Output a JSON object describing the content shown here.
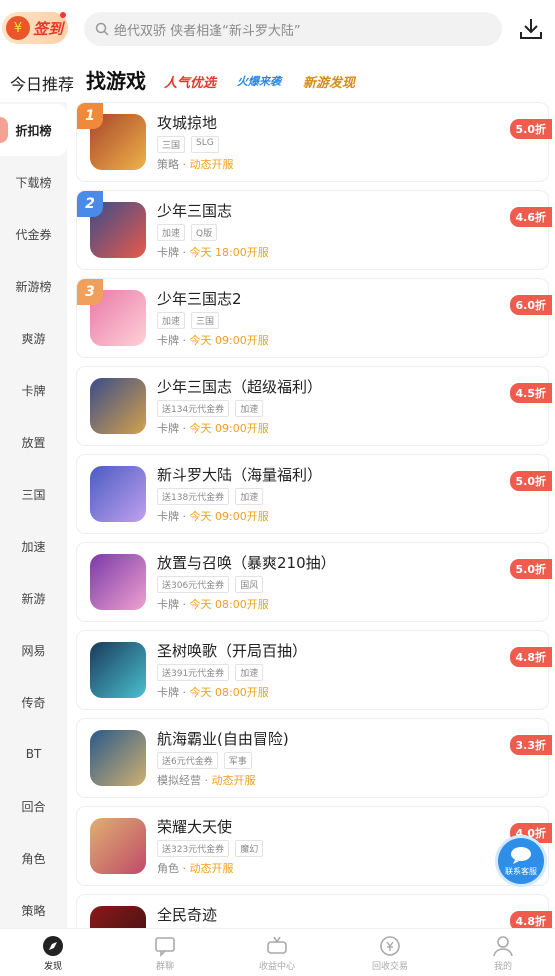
{
  "header": {
    "sign_label": "签到",
    "search_placeholder": "绝代双骄 侠者相逢“新斗罗大陆”",
    "download_icon": "download-icon"
  },
  "tabs": {
    "today": "今日推荐",
    "find": "找游戏",
    "hot": "人气优选",
    "boom": "火爆来袭",
    "new": "新游发现"
  },
  "sidebar": {
    "items": [
      "折扣榜",
      "下载榜",
      "代金券",
      "新游榜",
      "爽游",
      "卡牌",
      "放置",
      "三国",
      "加速",
      "新游",
      "网易",
      "传奇",
      "BT",
      "回合",
      "角色",
      "策略"
    ]
  },
  "games": [
    {
      "rank": "1",
      "name": "攻城掠地",
      "tags": [
        "三国",
        "SLG"
      ],
      "genre": "策略",
      "sep": " · ",
      "status": "动态开服",
      "discount": "5.0折"
    },
    {
      "rank": "2",
      "name": "少年三国志",
      "tags": [
        "加速",
        "Q版"
      ],
      "genre": "卡牌",
      "sep": " · ",
      "status": "今天 18:00开服",
      "discount": "4.6折"
    },
    {
      "rank": "3",
      "name": "少年三国志2",
      "tags": [
        "加速",
        "三国"
      ],
      "genre": "卡牌",
      "sep": " · ",
      "status": "今天 09:00开服",
      "discount": "6.0折"
    },
    {
      "rank": "",
      "name": "少年三国志（超级福利）",
      "tags": [
        "送134元代金券",
        "加速"
      ],
      "genre": "卡牌",
      "sep": " · ",
      "status": "今天 09:00开服",
      "discount": "4.5折"
    },
    {
      "rank": "",
      "name": "新斗罗大陆（海量福利）",
      "tags": [
        "送138元代金券",
        "加速"
      ],
      "genre": "卡牌",
      "sep": " · ",
      "status": "今天 09:00开服",
      "discount": "5.0折"
    },
    {
      "rank": "",
      "name": "放置与召唤（暴爽210抽）",
      "tags": [
        "送306元代金券",
        "国风"
      ],
      "genre": "卡牌",
      "sep": " · ",
      "status": "今天 08:00开服",
      "discount": "5.0折"
    },
    {
      "rank": "",
      "name": "圣树唤歌（开局百抽）",
      "tags": [
        "送391元代金券",
        "加速"
      ],
      "genre": "卡牌",
      "sep": " · ",
      "status": "今天 08:00开服",
      "discount": "4.8折"
    },
    {
      "rank": "",
      "name": "航海霸业(自由冒险)",
      "tags": [
        "送6元代金券",
        "军事"
      ],
      "genre": "模拟经营",
      "sep": " · ",
      "status": "动态开服",
      "discount": "3.3折"
    },
    {
      "rank": "",
      "name": "荣耀大天使",
      "tags": [
        "送323元代金券",
        "魔幻"
      ],
      "genre": "角色",
      "sep": " · ",
      "status": "动态开服",
      "discount": "4.0折"
    },
    {
      "rank": "",
      "name": "全民奇迹",
      "tags": [],
      "genre": "",
      "sep": "",
      "status": "",
      "discount": "4.8折"
    }
  ],
  "service_label": "联系客服",
  "bottom_nav": [
    "发现",
    "群聊",
    "收益中心",
    "回收交易",
    "我的"
  ],
  "colors": {
    "accent": "#ef5c4e",
    "highlight": "#f0a020",
    "service": "#2f8fe8"
  }
}
